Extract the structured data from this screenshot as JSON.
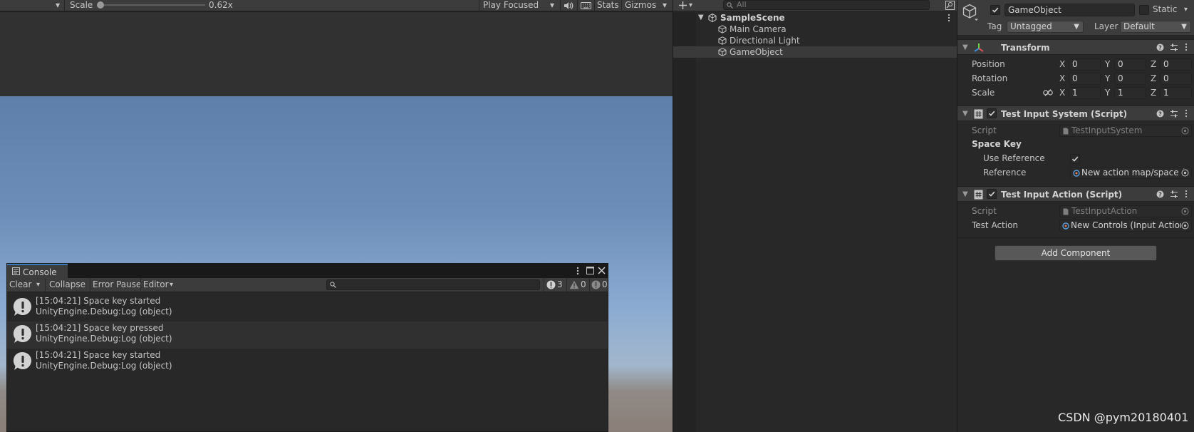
{
  "game": {
    "toolbar": {
      "scale_label": "Scale",
      "scale_value": "0.62x",
      "scale_level": 0.62,
      "play_mode": "Play Focused",
      "stats": "Stats",
      "gizmos": "Gizmos"
    }
  },
  "console": {
    "tab_label": "Console",
    "toolbar": {
      "clear": "Clear",
      "collapse": "Collapse",
      "error_pause": "Error Pause",
      "editor": "Editor",
      "log_count": "3",
      "warning_count": "0",
      "error_count": "0"
    },
    "logs": [
      {
        "message": "[15:04:21] Space key started",
        "source": "UnityEngine.Debug:Log (object)"
      },
      {
        "message": "[15:04:21] Space key pressed",
        "source": "UnityEngine.Debug:Log (object)"
      },
      {
        "message": "[15:04:21] Space key started",
        "source": "UnityEngine.Debug:Log (object)"
      }
    ]
  },
  "hierarchy": {
    "search_placeholder": "All",
    "scene": "SampleScene",
    "items": [
      "Main Camera",
      "Directional Light",
      "GameObject"
    ],
    "selected": "GameObject"
  },
  "inspector": {
    "object_name": "GameObject",
    "static_label": "Static",
    "tag_label": "Tag",
    "tag_value": "Untagged",
    "layer_label": "Layer",
    "layer_value": "Default",
    "transform": {
      "title": "Transform",
      "position_label": "Position",
      "rotation_label": "Rotation",
      "scale_label": "Scale",
      "axis_x": "X",
      "axis_y": "Y",
      "axis_z": "Z",
      "position": [
        "0",
        "0",
        "0"
      ],
      "rotation": [
        "0",
        "0",
        "0"
      ],
      "scale": [
        "1",
        "1",
        "1"
      ]
    },
    "test_input_system": {
      "title": "Test Input System (Script)",
      "script_label": "Script",
      "script_value": "TestInputSystem",
      "space_key_label": "Space Key",
      "use_reference_label": "Use Reference",
      "reference_label": "Reference",
      "reference_value": "New action map/space ("
    },
    "test_input_action": {
      "title": "Test Input Action (Script)",
      "script_label": "Script",
      "script_value": "TestInputAction",
      "test_action_label": "Test Action",
      "test_action_value": "New Controls (Input Action"
    },
    "add_component": "Add Component"
  },
  "watermark": "CSDN @pym20180401",
  "colors": {
    "panel_bg": "#282828",
    "toolbar_bg": "#3c3c3c",
    "text": "#c4c4c4",
    "accent": "#3a79bb",
    "field_bg": "#2a2a2a"
  }
}
